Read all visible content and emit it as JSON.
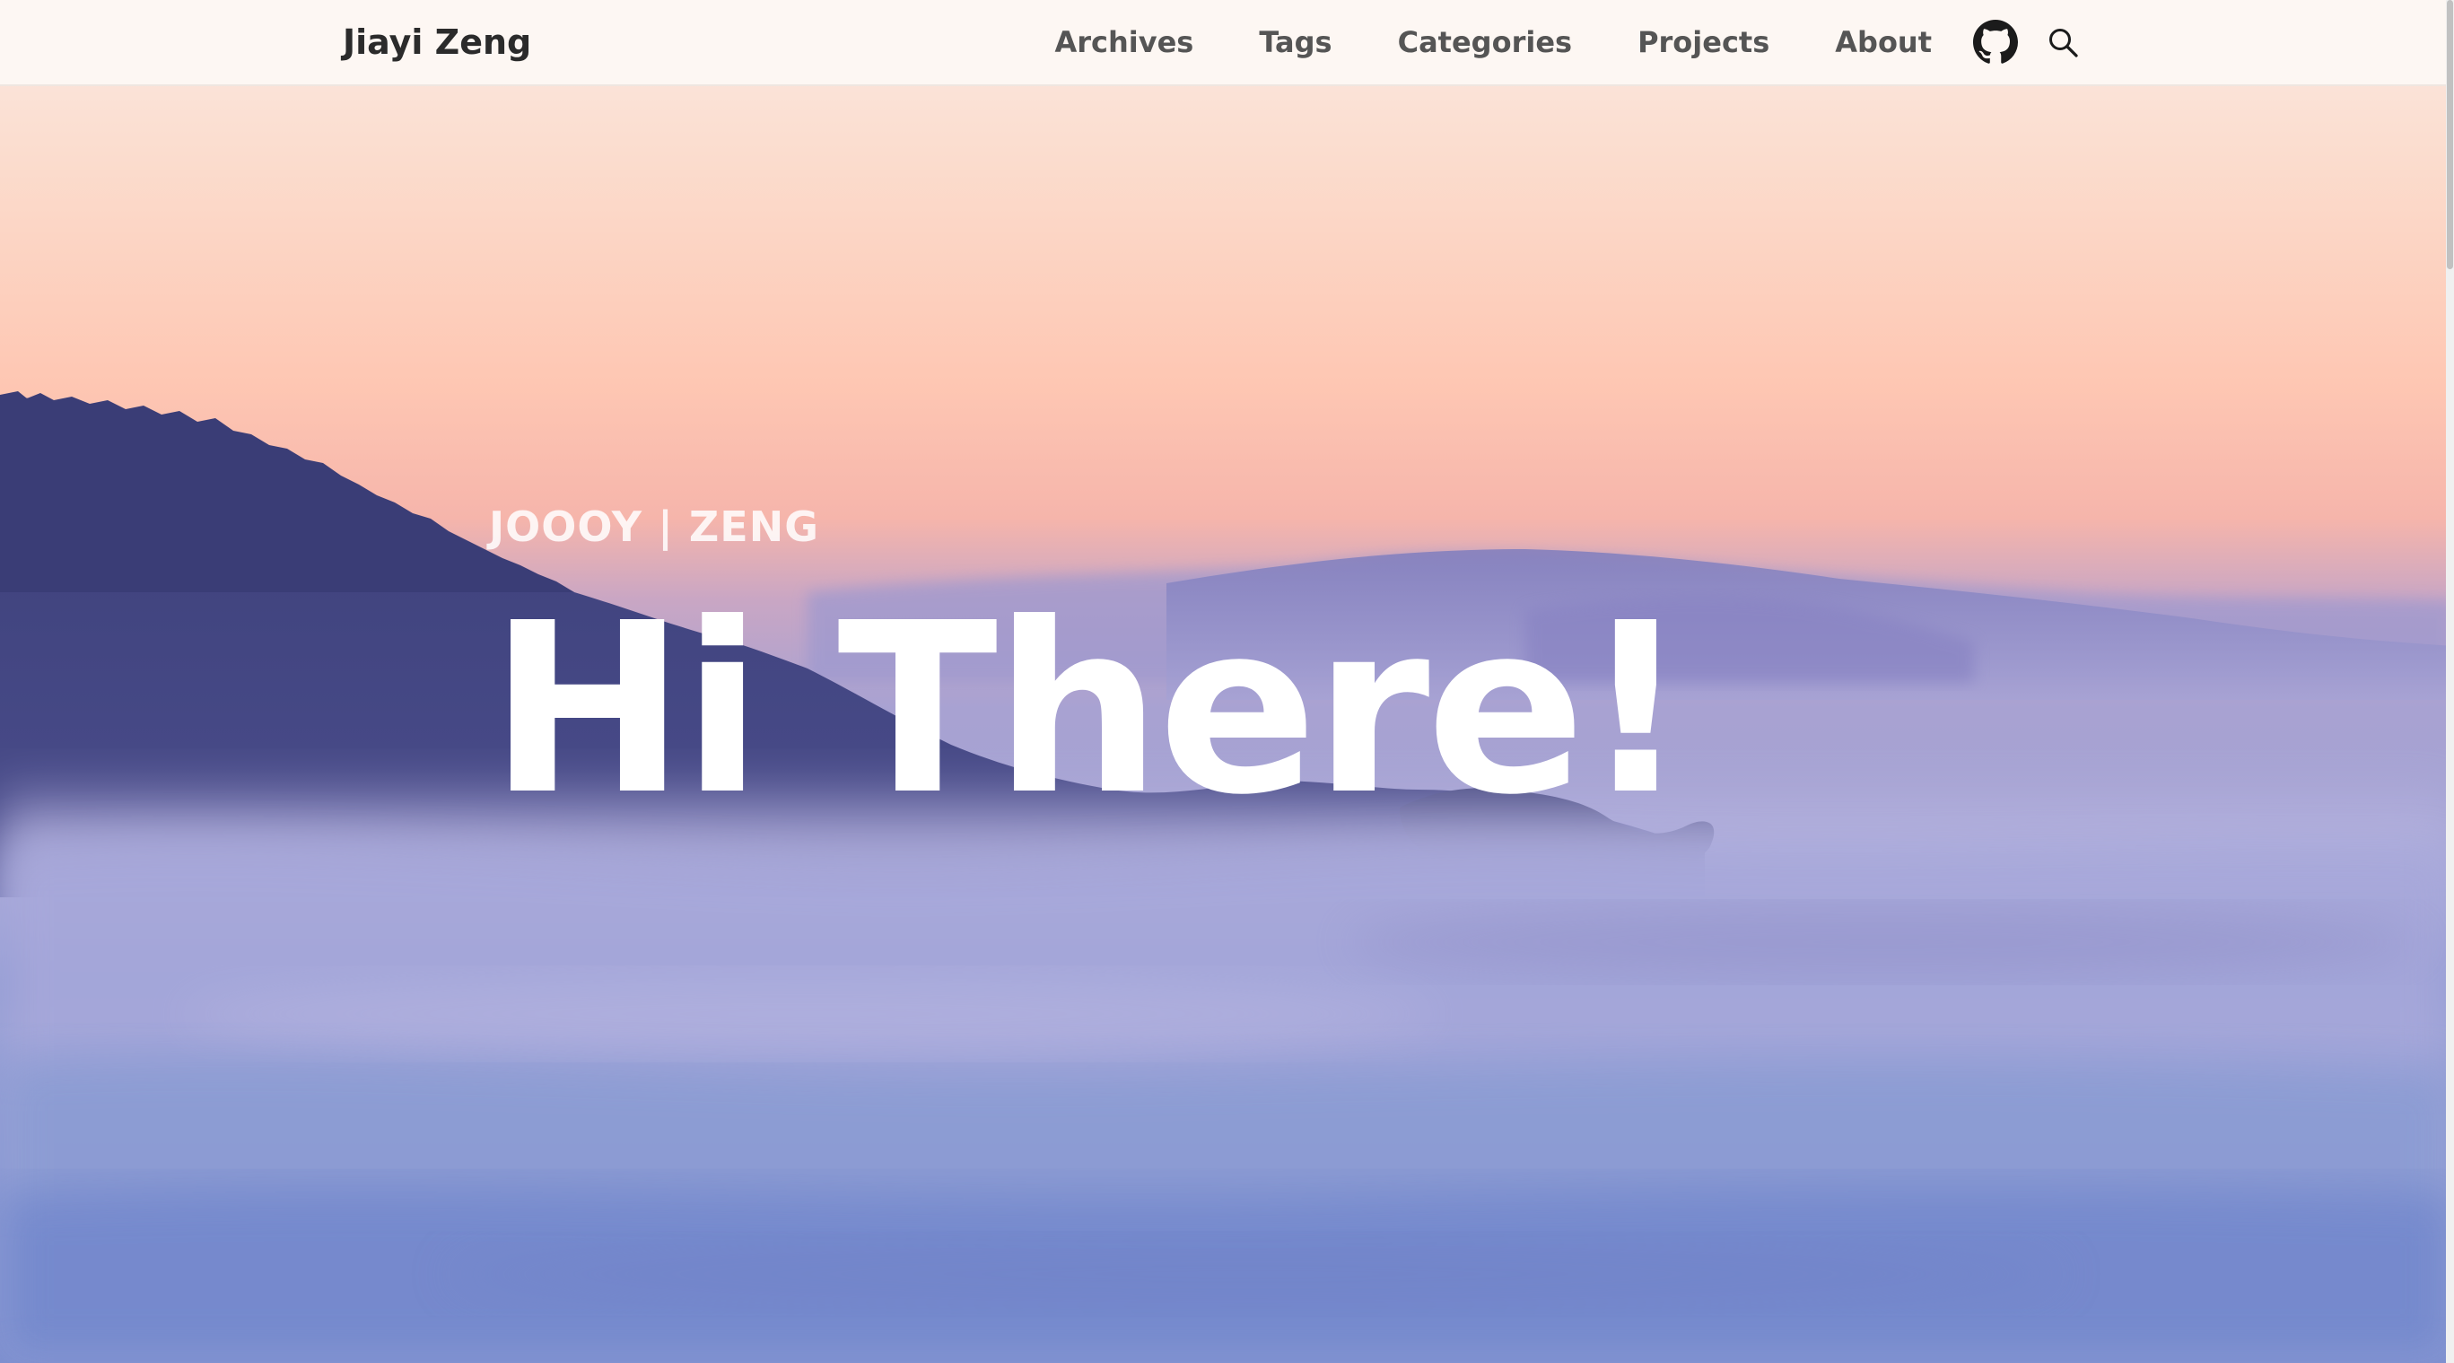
{
  "navbar": {
    "brand": "Jiayi Zeng",
    "links": [
      {
        "label": "Archives"
      },
      {
        "label": "Tags"
      },
      {
        "label": "Categories"
      },
      {
        "label": "Projects"
      },
      {
        "label": "About"
      }
    ],
    "icons": [
      "github-icon",
      "search-icon"
    ]
  },
  "hero": {
    "subtitle": "JOOOY | ZENG",
    "title": "Hi There!"
  },
  "colors": {
    "navbar_bg": "#fdf7f3",
    "sky_top": "#fbe9e1",
    "sky_peach": "#ffc3b0",
    "mist_purple": "#9a9ad4",
    "mountain_dark": "#3d3f78",
    "bottom_blue": "#7a8cd0"
  }
}
